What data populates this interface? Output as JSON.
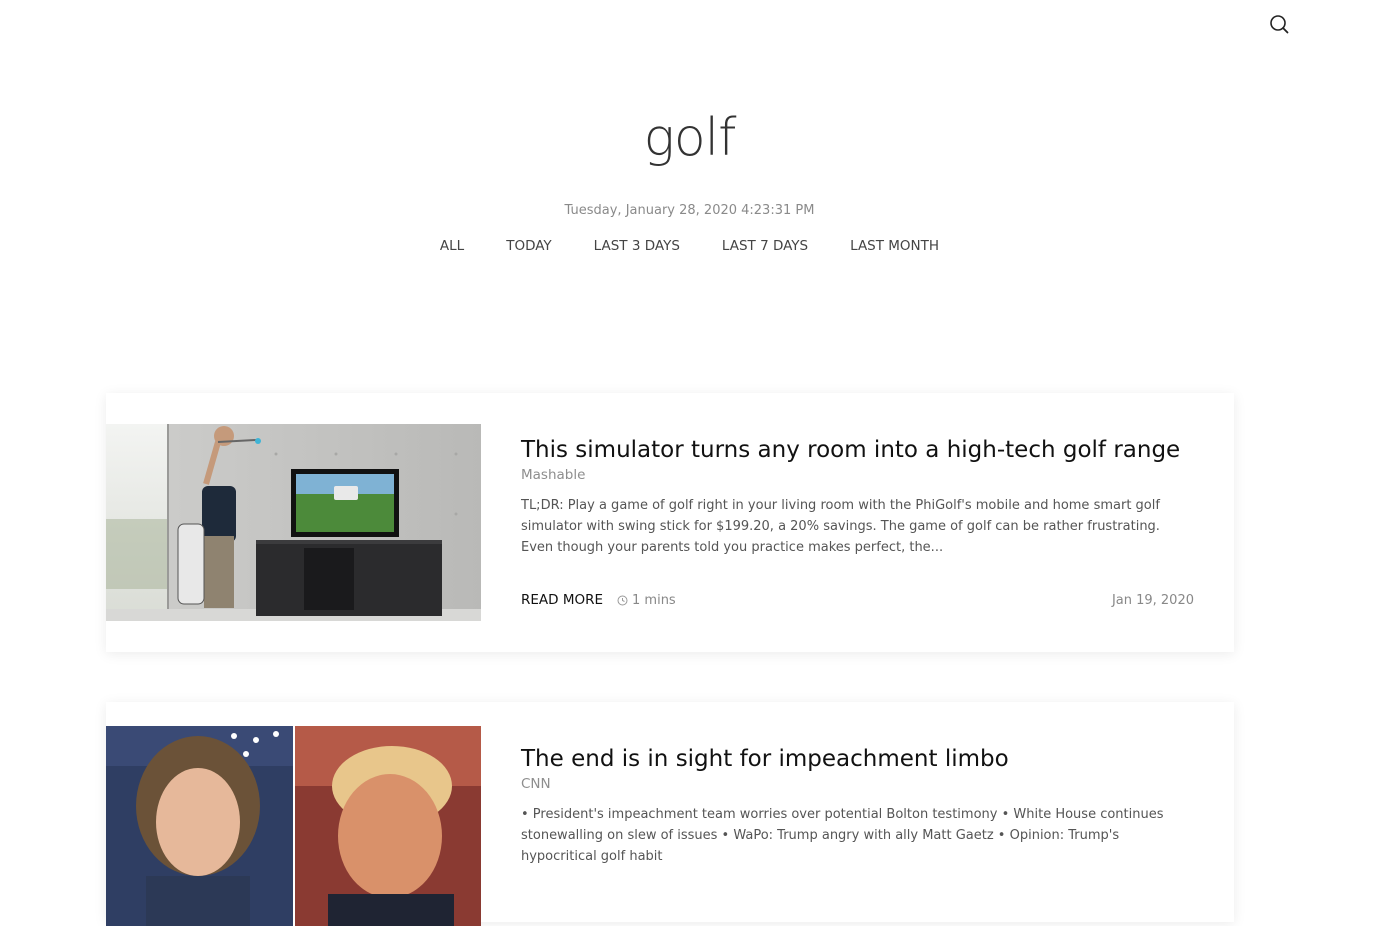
{
  "search": {
    "icon": "search-icon"
  },
  "page": {
    "title": "golf",
    "datetime": "Tuesday, January 28, 2020 4:23:31 PM"
  },
  "filters": [
    "ALL",
    "TODAY",
    "LAST 3 DAYS",
    "LAST 7 DAYS",
    "LAST MONTH"
  ],
  "articles": [
    {
      "title": "This simulator turns any room into a high-tech golf range",
      "source": "Mashable",
      "summary": "TL;DR: Play a game of golf right in your living room with the PhiGolf's mobile and home smart golf simulator with swing stick for $199.20, a 20% savings. The game of golf can be rather frustrating. Even though your parents told you practice makes perfect, the...",
      "read_more": "READ MORE",
      "read_time": "1 mins",
      "date": "Jan 19, 2020"
    },
    {
      "title": "The end is in sight for impeachment limbo",
      "source": "CNN",
      "summary": "• President's impeachment team worries over potential Bolton testimony • White House continues stonewalling on slew of issues • WaPo: Trump angry with ally Matt Gaetz • Opinion: Trump's hypocritical golf habit"
    }
  ]
}
